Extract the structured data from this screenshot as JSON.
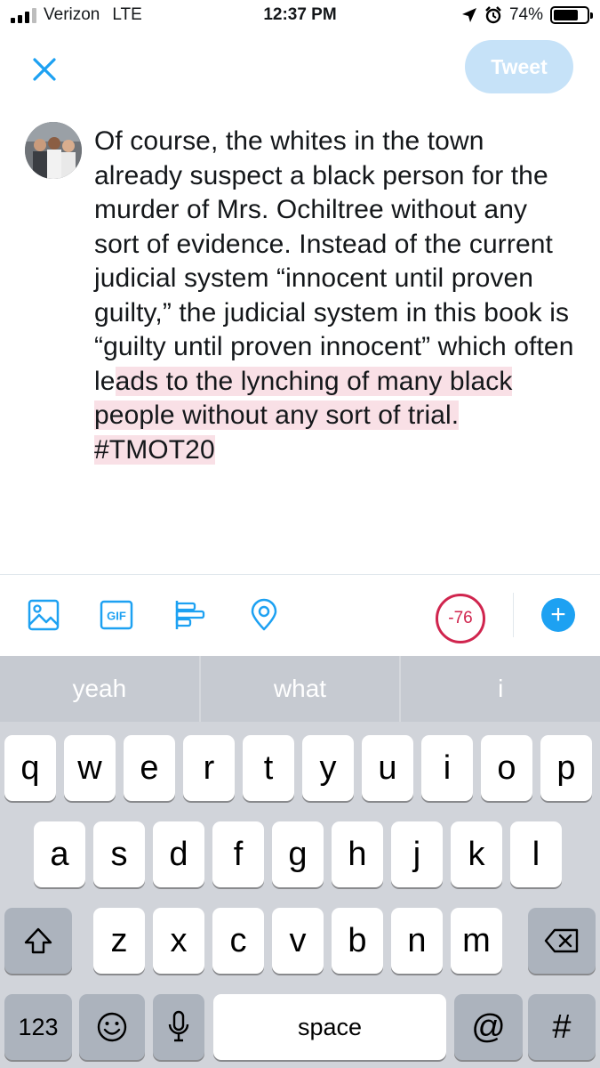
{
  "status_bar": {
    "carrier": "Verizon",
    "network": "LTE",
    "time": "12:37 PM",
    "battery_percent": "74%",
    "battery_level": 0.74,
    "location_icon": "location-arrow-icon",
    "alarm_icon": "alarm-clock-icon"
  },
  "compose": {
    "tweet_label": "Tweet",
    "text_within_limit": "Of course, the whites in the town already suspect a black person for the murder of Mrs. Ochiltree without any sort of evidence. Instead of the current judicial system “innocent until proven guilty,” the judicial system in this book is “guilty until proven innocent” which often le",
    "text_over_limit": "ads to the lynching of many black people without any sort of trial. #TMOT20",
    "char_counter": "-76"
  },
  "toolbar": {
    "icons": [
      "image-icon",
      "gif-icon",
      "poll-icon",
      "location-pin-icon",
      "add-icon"
    ]
  },
  "keyboard": {
    "suggestions": [
      "yeah",
      "what",
      "i"
    ],
    "row1": [
      "q",
      "w",
      "e",
      "r",
      "t",
      "y",
      "u",
      "i",
      "o",
      "p"
    ],
    "row2": [
      "a",
      "s",
      "d",
      "f",
      "g",
      "h",
      "j",
      "k",
      "l"
    ],
    "row3": [
      "z",
      "x",
      "c",
      "v",
      "b",
      "n",
      "m"
    ],
    "numbers_key": "123",
    "space_key": "space",
    "at_key": "@",
    "hash_key": "#"
  },
  "colors": {
    "accent": "#1da1f2",
    "tweet_button_disabled": "#c6e2f8",
    "over_limit": "#d0254e",
    "over_limit_highlight": "#f9e0e6"
  }
}
